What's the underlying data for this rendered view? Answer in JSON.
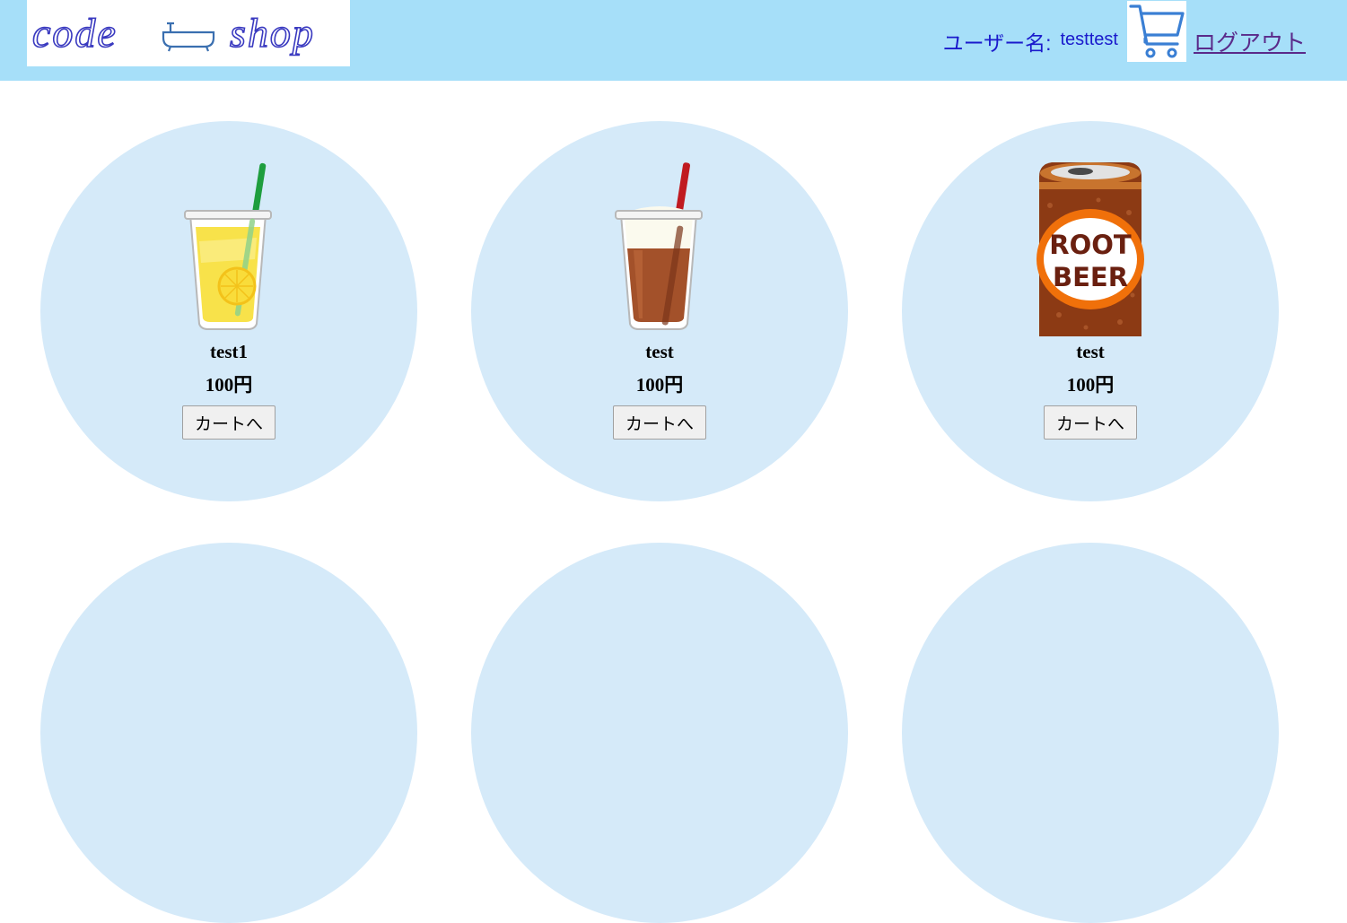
{
  "header": {
    "logo_text": "code 🛁 shop",
    "logo_icon": "bathtub-icon",
    "user_label": "ユーザー名:",
    "user_name": "testtest",
    "cart_icon": "shopping-cart-icon",
    "logout_label": "ログアウト",
    "background_color": "#a6dff9"
  },
  "products": [
    {
      "name": "test1",
      "price": "100円",
      "button_label": "カートへ",
      "image": "lemonade-cup-icon"
    },
    {
      "name": "test",
      "price": "100円",
      "button_label": "カートへ",
      "image": "iced-coffee-cup-icon"
    },
    {
      "name": "test",
      "price": "100円",
      "button_label": "カートへ",
      "image": "root-beer-can-icon",
      "image_text": [
        "ROOT",
        "BEER"
      ]
    }
  ],
  "colors": {
    "product_circle": "#d5eaf9",
    "link_text": "#1a1acc"
  }
}
